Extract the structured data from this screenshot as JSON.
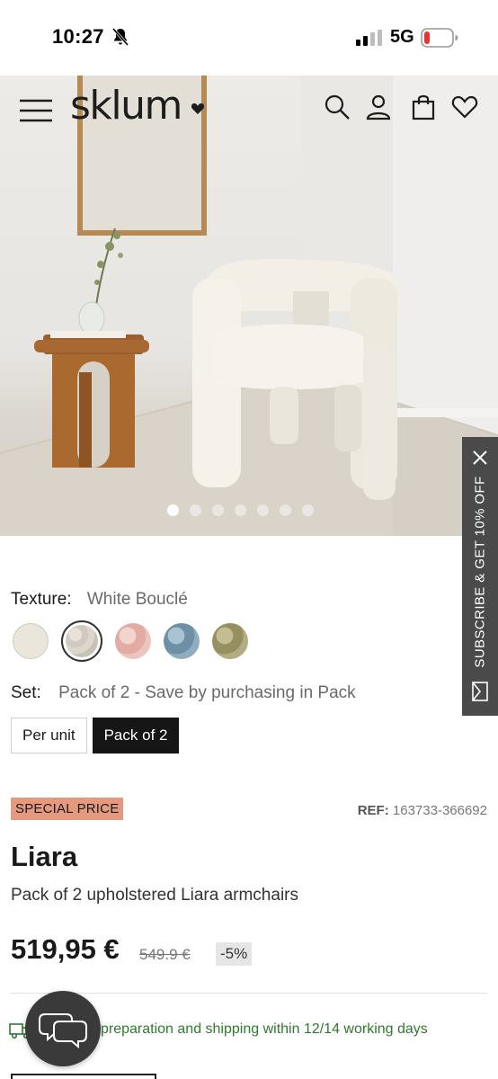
{
  "status_bar": {
    "time": "10:27",
    "network": "5G",
    "icons": [
      "bell-slash-icon",
      "signal-icon",
      "battery-icon"
    ]
  },
  "header": {
    "logo": "sklum",
    "icons": [
      "menu-icon",
      "search-icon",
      "account-icon",
      "cart-icon",
      "wishlist-icon"
    ]
  },
  "gallery": {
    "slides": 7,
    "active_index": 0
  },
  "subscribe_tab": {
    "label": "SUBSCRIBE & GET 10% OFF"
  },
  "texture": {
    "label": "Texture:",
    "value": "White Bouclé",
    "swatches": [
      {
        "name": "cream",
        "color": "#ebe6dc"
      },
      {
        "name": "white-boucle",
        "color": "#d8d3ca",
        "selected": true
      },
      {
        "name": "pink",
        "color": "#e8bdb6"
      },
      {
        "name": "blue",
        "color": "#7e9db2"
      },
      {
        "name": "olive",
        "color": "#a7a174"
      }
    ]
  },
  "set": {
    "label": "Set:",
    "value": "Pack of 2 - Save by purchasing in Pack",
    "options": [
      {
        "label": "Per unit",
        "active": false
      },
      {
        "label": "Pack of 2",
        "active": true
      }
    ]
  },
  "product": {
    "badge": "SPECIAL PRICE",
    "ref_label": "REF:",
    "ref_value": "163733-366692",
    "title": "Liara",
    "subtitle": "Pack of 2 upholstered Liara armchairs",
    "price": "519,95 €",
    "old_price": "549.9 €",
    "discount": "-5%"
  },
  "shipping": {
    "text": "preparation and shipping within 12/14 working days"
  },
  "colors": {
    "accent_badge": "#e59a7f",
    "shipping_green": "#2f7a2f",
    "dark": "#161616"
  }
}
